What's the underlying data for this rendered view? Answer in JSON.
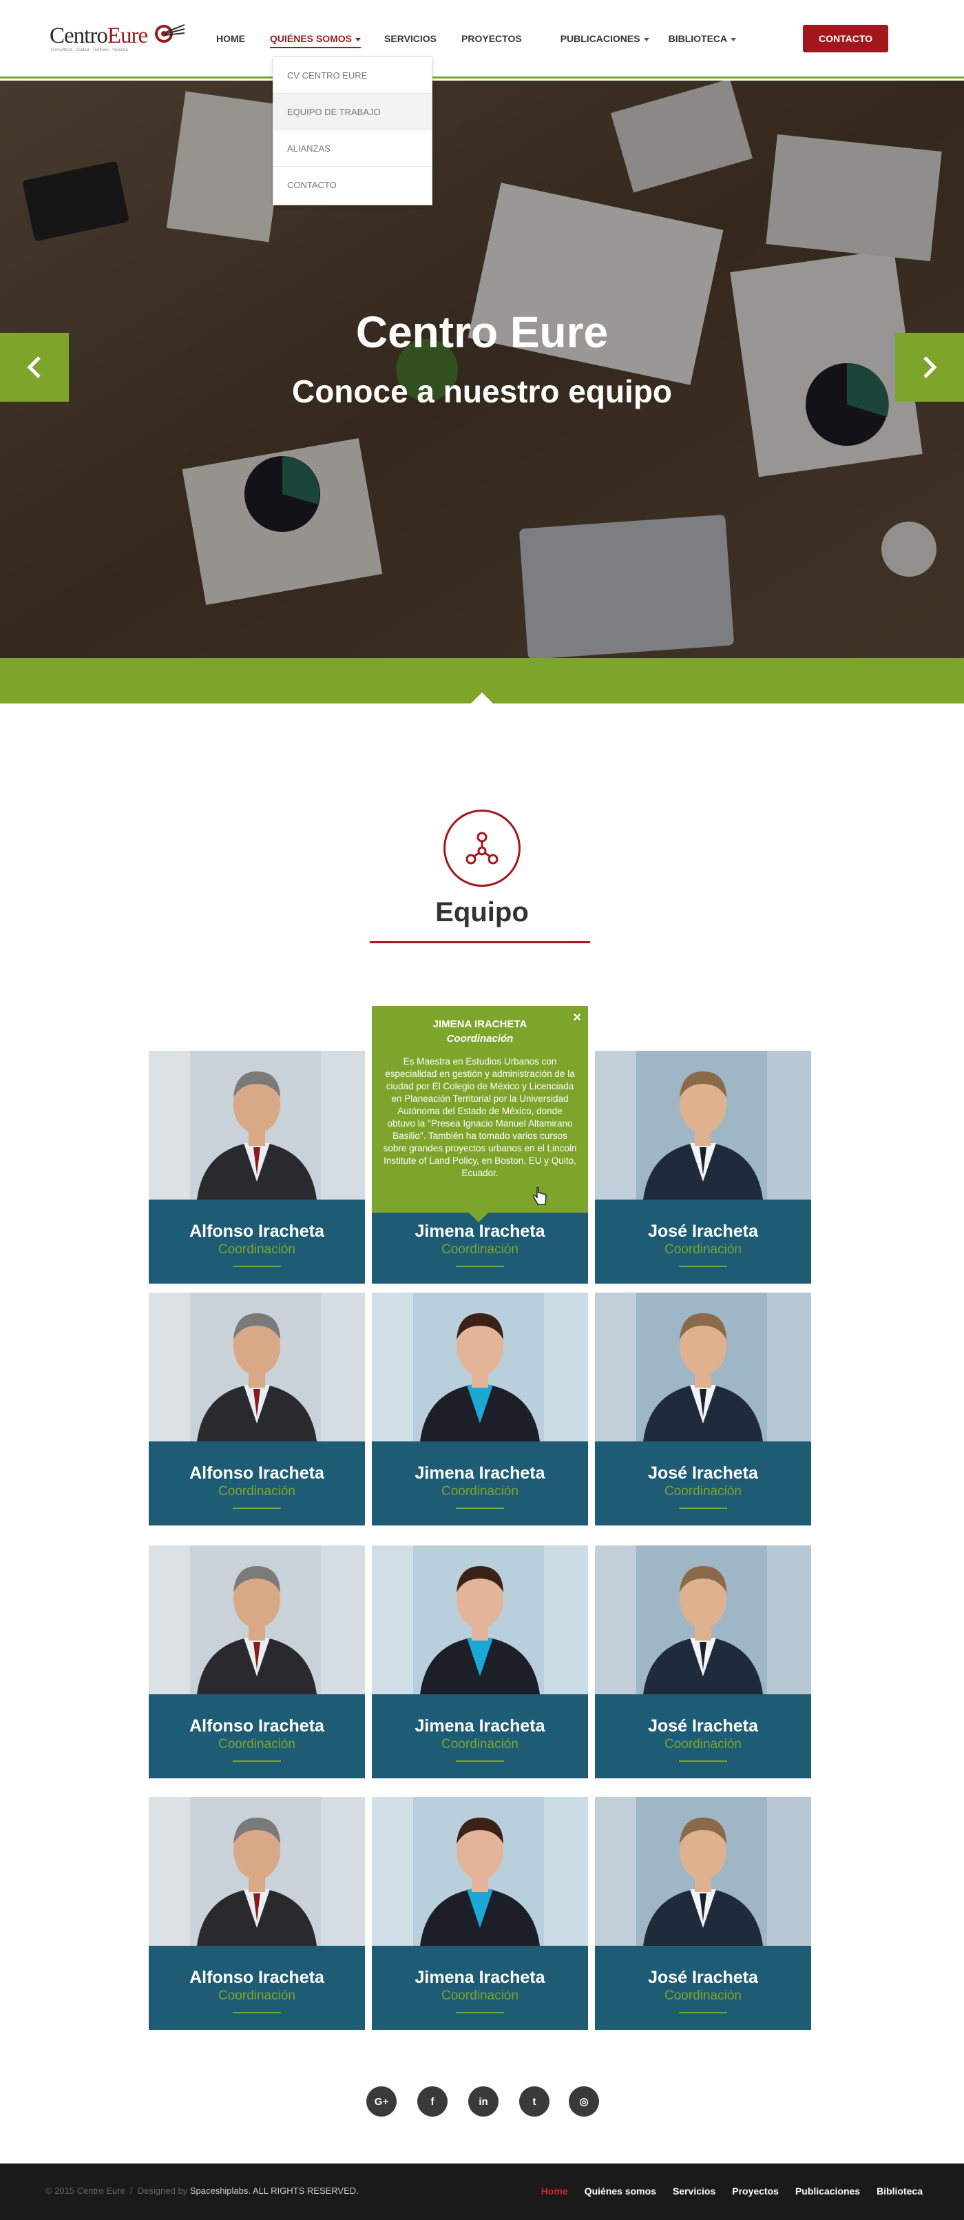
{
  "header": {
    "logo": {
      "part1": "Centro",
      "part2": "Eure",
      "tagline": "Consultoría · Ciudad · Territorio · Vivienda"
    },
    "nav": [
      {
        "label": "HOME",
        "dropdown": false
      },
      {
        "label": "QUIÉNES SOMOS",
        "dropdown": true,
        "active": true
      },
      {
        "label": "SERVICIOS",
        "dropdown": false
      },
      {
        "label": "PROYECTOS",
        "dropdown": false
      },
      {
        "label": "PUBLICACIONES",
        "dropdown": true
      },
      {
        "label": "BIBLIOTECA",
        "dropdown": true
      }
    ],
    "contact_label": "CONTACTO",
    "dropdown": [
      "CV CENTRO EURE",
      "EQUIPO DE TRABAJO",
      "ALIANZAS",
      "CONTACTO"
    ]
  },
  "hero": {
    "title": "Centro Eure",
    "subtitle": "Conoce a nuestro equipo",
    "prev_icon": "chevron-left-icon",
    "next_icon": "chevron-right-icon"
  },
  "team": {
    "title": "Equipo",
    "icon": "network-icon",
    "members": [
      {
        "name": "Alfonso Iracheta",
        "role": "Coordinación"
      },
      {
        "name": "Jimena Iracheta",
        "role": "Coordinación"
      },
      {
        "name": "José Iracheta",
        "role": "Coordinación"
      },
      {
        "name": "Alfonso Iracheta",
        "role": "Coordinación"
      },
      {
        "name": "Jimena Iracheta",
        "role": "Coordinación"
      },
      {
        "name": "José Iracheta",
        "role": "Coordinación"
      },
      {
        "name": "Alfonso Iracheta",
        "role": "Coordinación"
      },
      {
        "name": "Jimena Iracheta",
        "role": "Coordinación"
      },
      {
        "name": "José Iracheta",
        "role": "Coordinación"
      },
      {
        "name": "Alfonso Iracheta",
        "role": "Coordinación"
      },
      {
        "name": "Jimena Iracheta",
        "role": "Coordinación"
      },
      {
        "name": "José Iracheta",
        "role": "Coordinación"
      }
    ],
    "popup": {
      "name": "JIMENA IRACHETA",
      "role": "Coordinación",
      "bio": "Es Maestra en Estudios Urbanos con especialidad en gestión y administración de la ciudad por El Colegio de México y Licenciada en Planeación Territorial por la Universidad Autónoma del Estado de México, donde obtuvo la \"Presea Ignacio Manuel Altamirano Basilio\". También ha tomado varios cursos sobre grandes proyectos urbanos en el Lincoln Institute of Land Policy, en Boston, EU y Quito, Ecuador.",
      "close": "×"
    }
  },
  "social": [
    {
      "icon": "google-plus-icon",
      "glyph": "G+"
    },
    {
      "icon": "facebook-icon",
      "glyph": "f"
    },
    {
      "icon": "linkedin-icon",
      "glyph": "in"
    },
    {
      "icon": "twitter-icon",
      "glyph": "t"
    },
    {
      "icon": "instagram-icon",
      "glyph": "◎"
    }
  ],
  "footer": {
    "copyright": "© 2015 Centro Eure",
    "separator": "/",
    "designed_by": "Designed by",
    "designer": "Spaceshiplabs",
    "rights": ". ALL RIGHTS RESERVED.",
    "nav": [
      "Home",
      "Quiénes somos",
      "Servicios",
      "Proyectos",
      "Publicaciones",
      "Biblioteca"
    ]
  },
  "colors": {
    "accent_red": "#a3161b",
    "accent_green": "#7da52b",
    "card_blue": "#1e5b74"
  }
}
